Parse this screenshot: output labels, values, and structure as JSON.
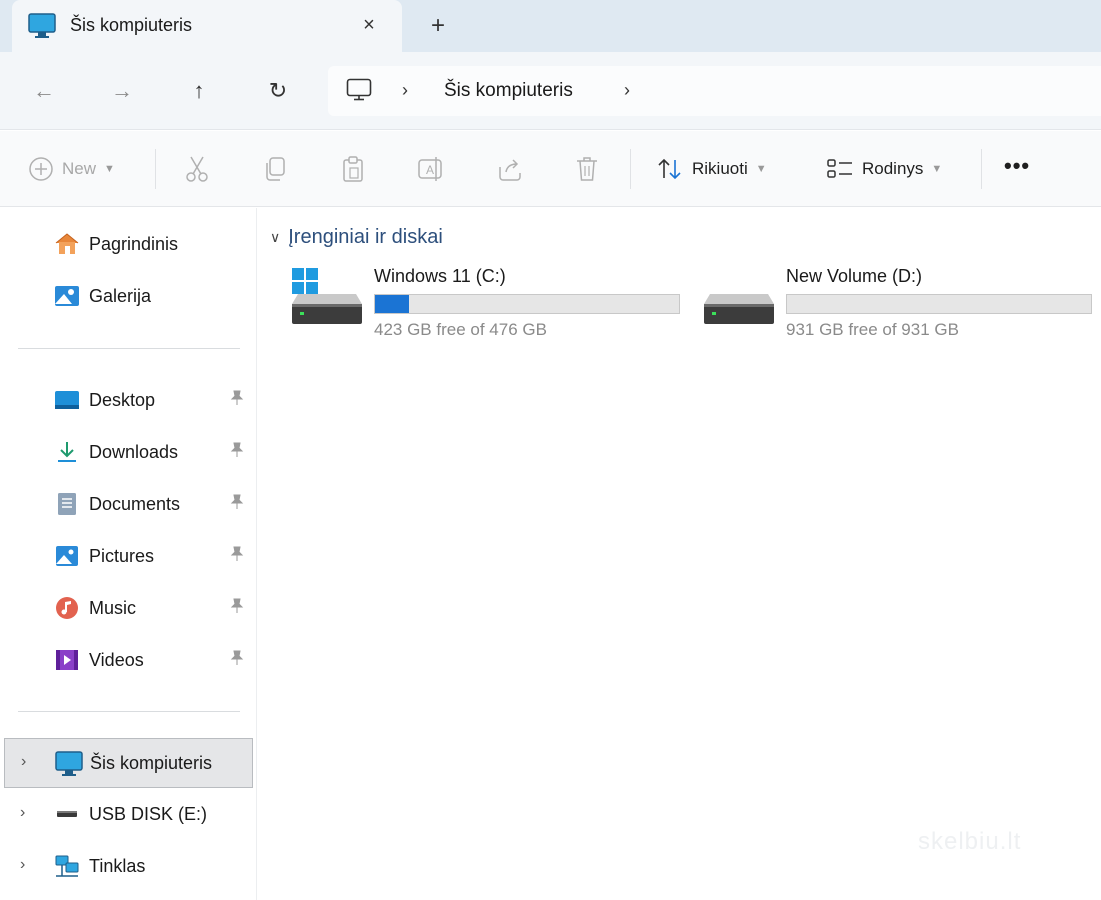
{
  "tab": {
    "title": "Šis kompiuteris",
    "close_icon": "×",
    "new_tab_icon": "+"
  },
  "nav": {
    "back_icon": "←",
    "forward_icon": "→",
    "up_icon": "↑",
    "refresh_icon": "↻",
    "breadcrumb": [
      "Šis kompiuteris"
    ],
    "sep": "›"
  },
  "toolbar": {
    "new_label": "New",
    "sort_label": "Rikiuoti",
    "view_label": "Rodinys",
    "more_label": "•••"
  },
  "sidebar": {
    "home": "Pagrindinis",
    "gallery": "Galerija",
    "quick_access": [
      {
        "label": "Desktop",
        "icon": "desktop-icon"
      },
      {
        "label": "Downloads",
        "icon": "downloads-icon"
      },
      {
        "label": "Documents",
        "icon": "documents-icon"
      },
      {
        "label": "Pictures",
        "icon": "pictures-icon"
      },
      {
        "label": "Music",
        "icon": "music-icon"
      },
      {
        "label": "Videos",
        "icon": "videos-icon"
      }
    ],
    "this_pc": "Šis kompiuteris",
    "usb": "USB DISK (E:)",
    "network": "Tinklas",
    "pin_glyph": "📌"
  },
  "main": {
    "group_title": "Įrenginiai ir diskai",
    "drives": [
      {
        "name": "Windows 11 (C:)",
        "free_text": "423 GB free of 476 GB",
        "used_fraction": 0.111
      },
      {
        "name": "New Volume (D:)",
        "free_text": "931 GB free of 931 GB",
        "used_fraction": 0.0
      }
    ]
  },
  "colors": {
    "accent": "#1b74d4",
    "group_header": "#2d4f7c"
  },
  "watermark": "skelbiu.lt"
}
